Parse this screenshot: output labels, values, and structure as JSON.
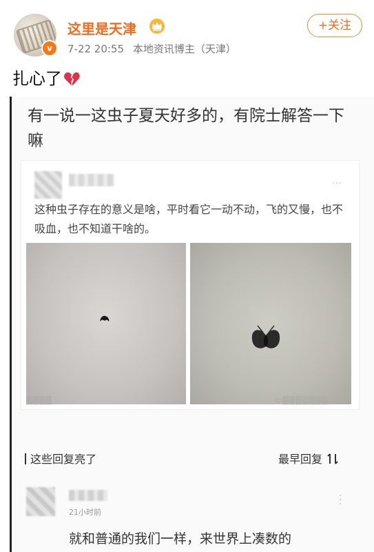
{
  "header": {
    "username": "这里是天津",
    "time": "7-22 20:55",
    "source": "本地资讯博主（天津）",
    "follow_label": "+关注"
  },
  "post": {
    "text": "扎心了"
  },
  "quoted": {
    "title": "有一说一这虫子夏天好多的，有院士解答一下嘛",
    "inner_text": "这种虫子存在的意义是啥，平时看它一动不动，飞的又慢，也不吸血，也不知道干啥的。",
    "replies_label": "这些回复亮了",
    "sort_label": "最早回复",
    "comment": {
      "time": "21小时前",
      "text": "就和普通的我们一样，来世界上凑数的"
    }
  },
  "colors": {
    "accent": "#f26b1d",
    "verify": "#f27a1a",
    "heart": "#e0304a"
  },
  "icons": [
    "crown-icon",
    "verified-icon",
    "broken-heart-icon",
    "more-icon",
    "sort-icon"
  ]
}
